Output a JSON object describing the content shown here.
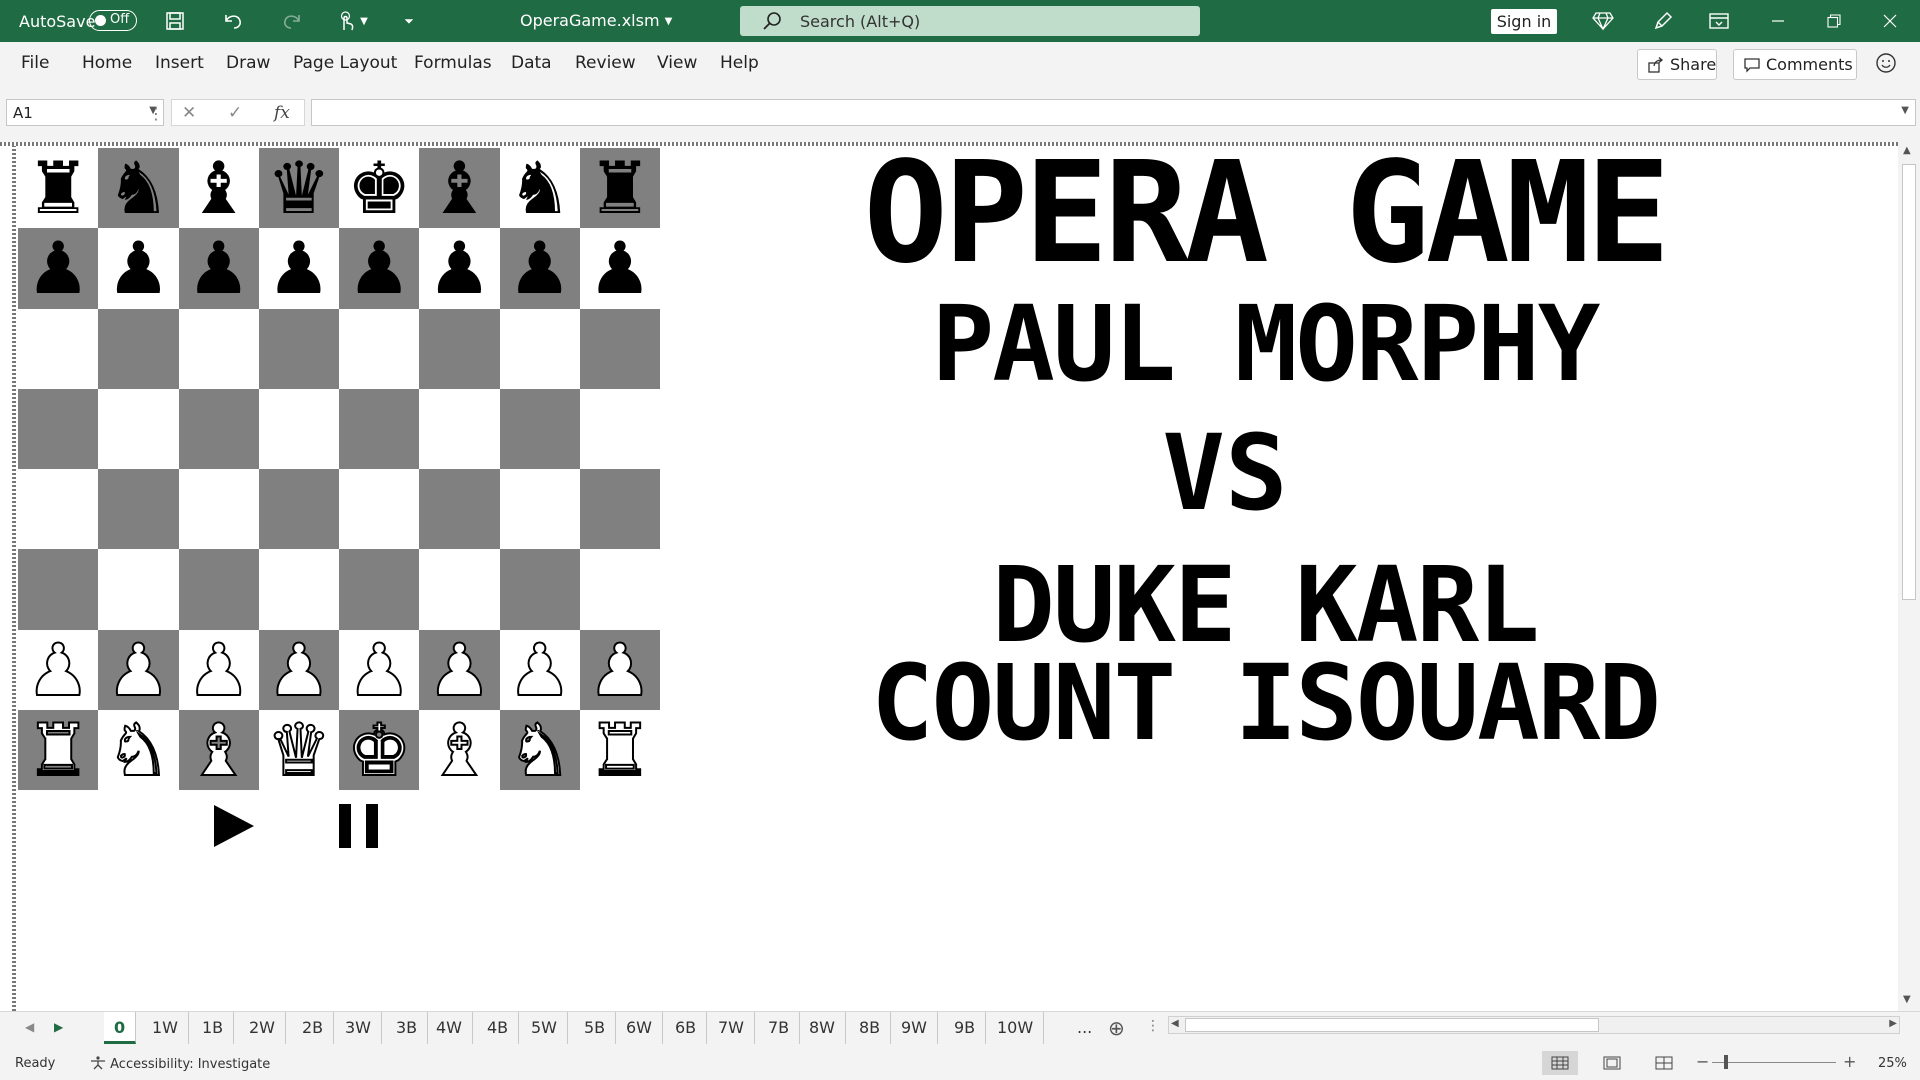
{
  "titlebar": {
    "autosave_label": "AutoSave",
    "autosave_state": "Off",
    "filename": "OperaGame.xlsm",
    "search_placeholder": "Search (Alt+Q)",
    "signin_label": "Sign in",
    "icons": [
      "save-icon",
      "undo-icon",
      "redo-icon",
      "touch-mode-icon",
      "customize-qat-icon",
      "diamond-icon",
      "pen-icon",
      "ribbon-display-icon",
      "minimize-icon",
      "restore-icon",
      "close-icon"
    ]
  },
  "menu": {
    "items": [
      "File",
      "Home",
      "Insert",
      "Draw",
      "Page Layout",
      "Formulas",
      "Data",
      "Review",
      "View",
      "Help"
    ],
    "share_label": "Share",
    "comments_label": "Comments"
  },
  "formula_bar": {
    "namebox_value": "A1",
    "formula_value": "",
    "fx_label": "fx"
  },
  "sheet": {
    "board": {
      "colors": {
        "light": "#ffffff",
        "dark": "#808080"
      },
      "ranks": [
        [
          {
            "piece": "♜",
            "side": "black"
          },
          {
            "piece": "♞",
            "side": "black"
          },
          {
            "piece": "♝",
            "side": "black"
          },
          {
            "piece": "♛",
            "side": "black"
          },
          {
            "piece": "♚",
            "side": "black"
          },
          {
            "piece": "♝",
            "side": "black"
          },
          {
            "piece": "♞",
            "side": "black"
          },
          {
            "piece": "♜",
            "side": "black"
          }
        ],
        [
          {
            "piece": "♟",
            "side": "black"
          },
          {
            "piece": "♟",
            "side": "black"
          },
          {
            "piece": "♟",
            "side": "black"
          },
          {
            "piece": "♟",
            "side": "black"
          },
          {
            "piece": "♟",
            "side": "black"
          },
          {
            "piece": "♟",
            "side": "black"
          },
          {
            "piece": "♟",
            "side": "black"
          },
          {
            "piece": "♟",
            "side": "black"
          }
        ],
        [
          null,
          null,
          null,
          null,
          null,
          null,
          null,
          null
        ],
        [
          null,
          null,
          null,
          null,
          null,
          null,
          null,
          null
        ],
        [
          null,
          null,
          null,
          null,
          null,
          null,
          null,
          null
        ],
        [
          null,
          null,
          null,
          null,
          null,
          null,
          null,
          null
        ],
        [
          {
            "piece": "♟",
            "side": "white"
          },
          {
            "piece": "♟",
            "side": "white"
          },
          {
            "piece": "♟",
            "side": "white"
          },
          {
            "piece": "♟",
            "side": "white"
          },
          {
            "piece": "♟",
            "side": "white"
          },
          {
            "piece": "♟",
            "side": "white"
          },
          {
            "piece": "♟",
            "side": "white"
          },
          {
            "piece": "♟",
            "side": "white"
          }
        ],
        [
          {
            "piece": "♜",
            "side": "white"
          },
          {
            "piece": "♞",
            "side": "white"
          },
          {
            "piece": "♝",
            "side": "white"
          },
          {
            "piece": "♛",
            "side": "white"
          },
          {
            "piece": "♚",
            "side": "white"
          },
          {
            "piece": "♝",
            "side": "white"
          },
          {
            "piece": "♞",
            "side": "white"
          },
          {
            "piece": "♜",
            "side": "white"
          }
        ]
      ]
    },
    "controls": {
      "play_icon": "play-icon",
      "pause_icon": "pause-icon"
    },
    "title_lines": [
      "OPERA GAME",
      "PAUL MORPHY",
      "VS",
      "DUKE KARL",
      "COUNT ISOUARD"
    ]
  },
  "tabs": {
    "items": [
      "0",
      "1W",
      "1B",
      "2W",
      "2B",
      "3W",
      "3B",
      "4W",
      "4B",
      "5W",
      "5B",
      "6W",
      "6B",
      "7W",
      "7B",
      "8W",
      "8B",
      "9W",
      "9B",
      "10W"
    ],
    "active": "0",
    "more_label": "..."
  },
  "status": {
    "ready": "Ready",
    "accessibility": "Accessibility: Investigate",
    "zoom": "25%"
  }
}
